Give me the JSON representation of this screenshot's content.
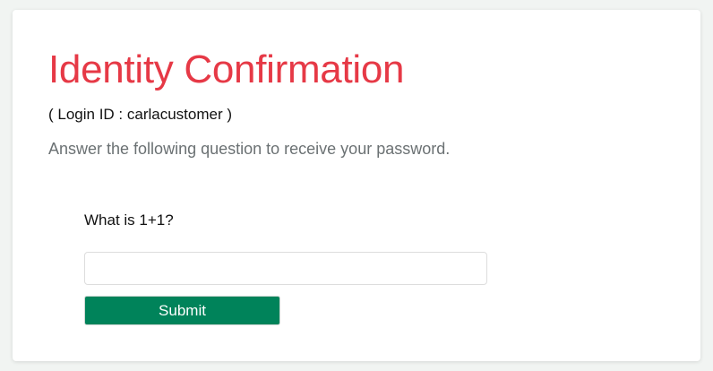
{
  "page": {
    "title": "Identity Confirmation",
    "login_id_line": "( Login ID :  carlacustomer )",
    "instruction": "Answer the following question to receive your password.",
    "question": "What is 1+1?",
    "answer": {
      "value": "",
      "placeholder": ""
    },
    "submit_label": "Submit"
  },
  "colors": {
    "title": "#e63946",
    "submit_button": "#00835a",
    "background": "#f1f4f2"
  }
}
